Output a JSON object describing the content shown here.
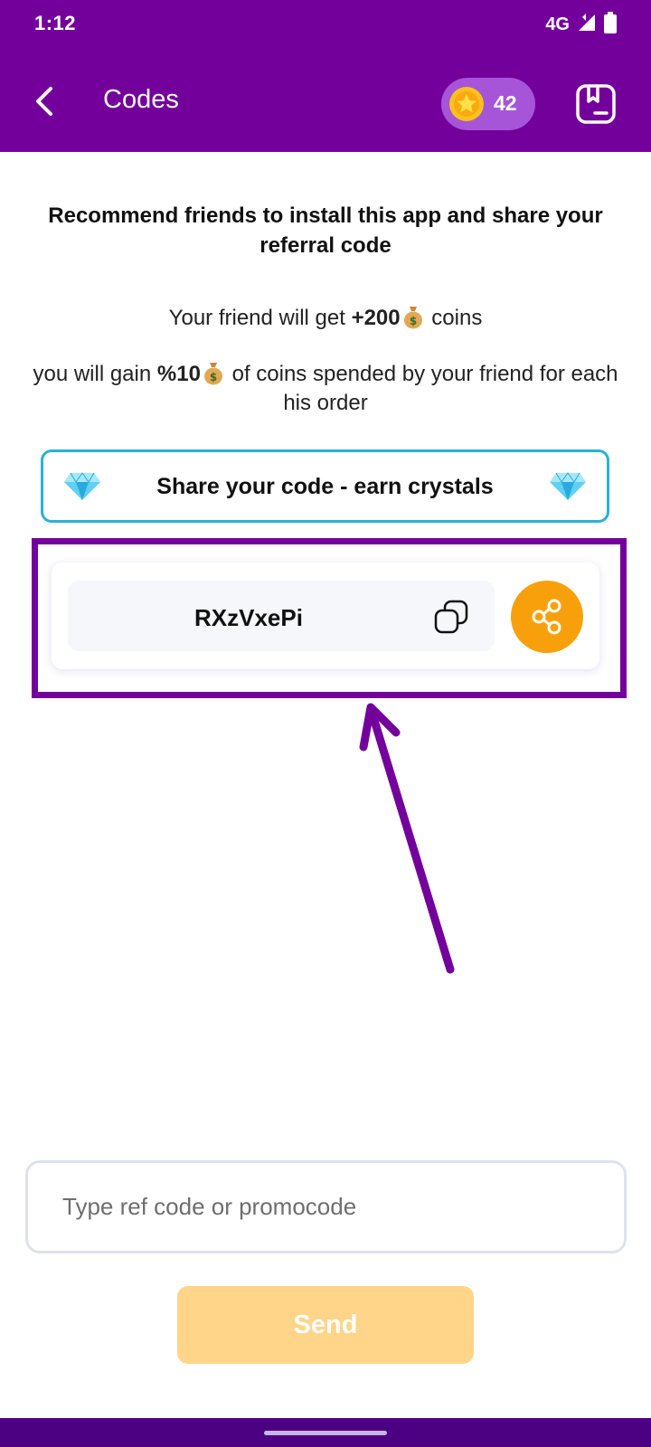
{
  "status_bar": {
    "time": "1:12",
    "network": "4G",
    "icons": [
      "signal-icon",
      "battery-icon"
    ]
  },
  "app_bar": {
    "title": "Codes",
    "back_icon": "back-arrow-icon",
    "coins": "42",
    "coin_icon": "star-coin-icon",
    "history_icon": "receipt-icon"
  },
  "content": {
    "headline": "Recommend friends to install this app and share your referral code",
    "friend_reward": {
      "prefix": "Your friend will get ",
      "amount": "+200",
      "suffix": " coins"
    },
    "your_reward": {
      "prefix": "you will gain ",
      "amount": "%10",
      "suffix": " of coins spended by your friend for each his order"
    },
    "coin_bag_icon": "money-bag-icon"
  },
  "banner": {
    "text": "Share your code - earn crystals",
    "icon": "gem-icon"
  },
  "referral": {
    "code": "RXzVxePi",
    "copy_icon": "copy-icon",
    "share_icon": "share-icon"
  },
  "promo": {
    "placeholder": "Type ref code or promocode",
    "value": "",
    "send_label": "Send"
  },
  "colors": {
    "primary": "#74009b",
    "coin_pill": "#a755d8",
    "accent_orange": "#f8a00b",
    "banner_border": "#29b2d4",
    "send_disabled": "#fed589"
  }
}
